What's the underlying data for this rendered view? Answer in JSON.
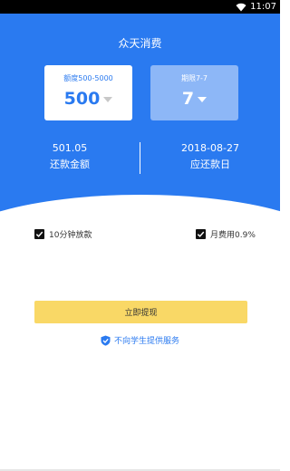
{
  "status_bar": {
    "time": "11:07"
  },
  "app": {
    "title": "众天消费"
  },
  "amount_card": {
    "label": "额度500-5000",
    "value": "500"
  },
  "period_card": {
    "label": "期限7-7",
    "value": "7"
  },
  "summary": {
    "repay_amount": "501.05",
    "repay_amount_label": "还款金额",
    "repay_date": "2018-08-27",
    "repay_date_label": "应还款日"
  },
  "options": {
    "left": {
      "label": "10分钟放款",
      "checked": true
    },
    "right": {
      "label": "月费用0.9%",
      "checked": true
    }
  },
  "submit": {
    "label": "立即提现"
  },
  "notice": {
    "text": "不向学生提供服务"
  },
  "colors": {
    "primary": "#2a7af0",
    "button": "#f9d866",
    "card_light": "#8db7f7"
  }
}
